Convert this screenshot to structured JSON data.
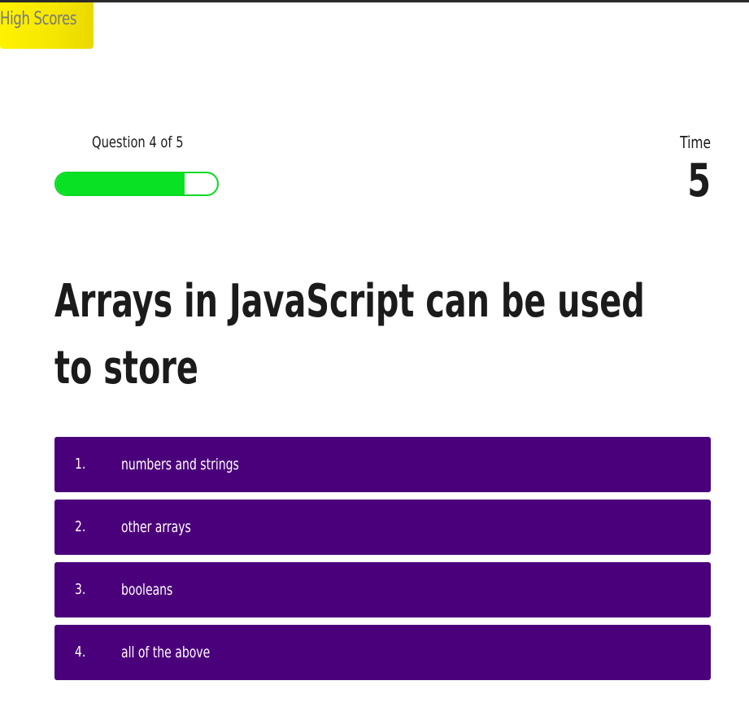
{
  "nav": {
    "high_scores_label": "High Scores",
    "accent_color": "#fff200"
  },
  "hud": {
    "progress_text": "Question 4 of 5",
    "progress_fraction": 0.8,
    "progress_color": "#09e124",
    "time_label": "Time",
    "time_value": "5"
  },
  "question": {
    "text": "Arrays in JavaScript can be used to store"
  },
  "choices": [
    {
      "number": "1.",
      "text": "numbers and strings"
    },
    {
      "number": "2.",
      "text": "other arrays"
    },
    {
      "number": "3.",
      "text": "booleans"
    },
    {
      "number": "4.",
      "text": "all of the above"
    }
  ],
  "colors": {
    "choice_background": "#4b007b",
    "choice_text": "#ffffff"
  }
}
